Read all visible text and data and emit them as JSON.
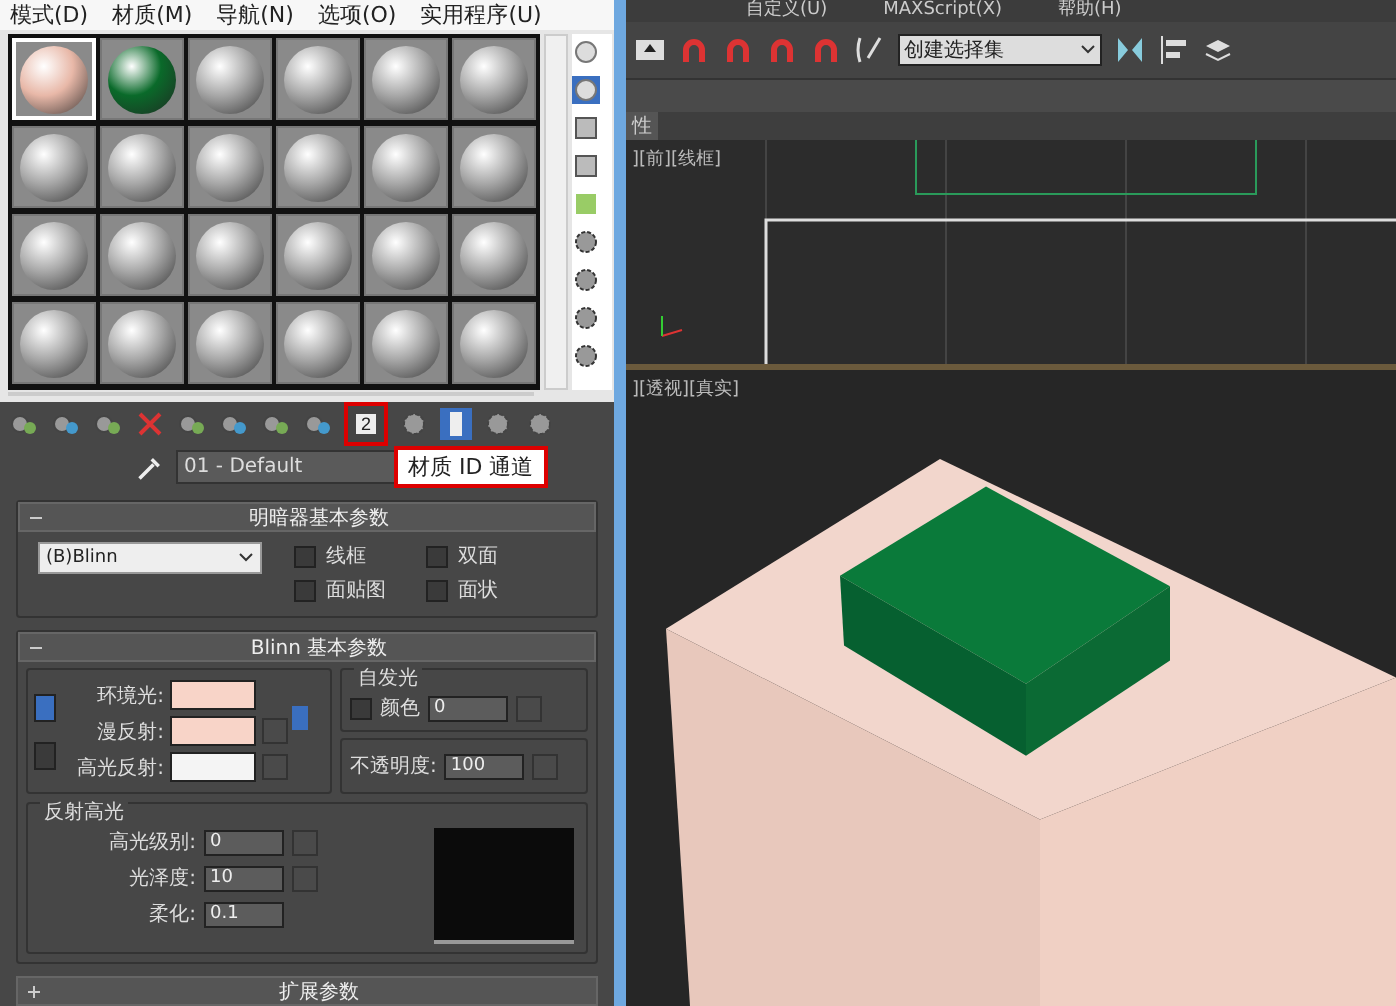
{
  "material_editor": {
    "menu": [
      "模式(D)",
      "材质(M)",
      "导航(N)",
      "选项(O)",
      "实用程序(U)"
    ],
    "sample_slots": [
      {
        "color": "#e8b8a8",
        "selected": true
      },
      {
        "color": "#0a6a2a",
        "selected": false
      },
      {
        "color": "#a8a8a8",
        "selected": false
      },
      {
        "color": "#a8a8a8",
        "selected": false
      },
      {
        "color": "#a8a8a8",
        "selected": false
      },
      {
        "color": "#a8a8a8",
        "selected": false
      },
      {
        "color": "#a8a8a8",
        "selected": false
      },
      {
        "color": "#a8a8a8",
        "selected": false
      },
      {
        "color": "#a8a8a8",
        "selected": false
      },
      {
        "color": "#a8a8a8",
        "selected": false
      },
      {
        "color": "#a8a8a8",
        "selected": false
      },
      {
        "color": "#a8a8a8",
        "selected": false
      },
      {
        "color": "#a8a8a8",
        "selected": false
      },
      {
        "color": "#a8a8a8",
        "selected": false
      },
      {
        "color": "#a8a8a8",
        "selected": false
      },
      {
        "color": "#a8a8a8",
        "selected": false
      },
      {
        "color": "#a8a8a8",
        "selected": false
      },
      {
        "color": "#a8a8a8",
        "selected": false
      },
      {
        "color": "#a8a8a8",
        "selected": false
      },
      {
        "color": "#a8a8a8",
        "selected": false
      },
      {
        "color": "#a8a8a8",
        "selected": false
      },
      {
        "color": "#a8a8a8",
        "selected": false
      },
      {
        "color": "#a8a8a8",
        "selected": false
      },
      {
        "color": "#a8a8a8",
        "selected": false
      }
    ],
    "id_channel_button": {
      "label": "2",
      "highlighted": true
    },
    "material_name": {
      "value": "01 - Default"
    },
    "tooltip": {
      "text": "材质 ID 通道",
      "highlighted": true
    },
    "shader_rollout": {
      "title": "明暗器基本参数",
      "expanded": true,
      "shader": "(B)Blinn",
      "options": [
        {
          "label": "线框",
          "checked": false
        },
        {
          "label": "双面",
          "checked": false
        },
        {
          "label": "面贴图",
          "checked": false
        },
        {
          "label": "面状",
          "checked": false
        }
      ]
    },
    "blinn_rollout": {
      "title": "Blinn 基本参数",
      "expanded": true,
      "colors": [
        {
          "label": "环境光:",
          "color": "#f8d4c8"
        },
        {
          "label": "漫反射:",
          "color": "#f8d4c8"
        },
        {
          "label": "高光反射:",
          "color": "#f4f4f4"
        }
      ],
      "self_illumination": {
        "title": "自发光",
        "label": "颜色",
        "checked": false,
        "value": "0"
      },
      "opacity": {
        "label": "不透明度:",
        "value": "100"
      },
      "specular": {
        "title": "反射高光",
        "fields": [
          {
            "label": "高光级别:",
            "value": "0"
          },
          {
            "label": "光泽度:",
            "value": "10"
          },
          {
            "label": "柔化:",
            "value": "0.1"
          }
        ]
      }
    },
    "extended_rollout": {
      "title": "扩展参数",
      "expanded": false
    }
  },
  "main_window": {
    "menu": [
      "自定义(U)",
      "MAXScript(X)",
      "帮助(H)"
    ],
    "selection_set": {
      "value": "创建选择集"
    },
    "tab": {
      "label": "性"
    },
    "viewports": [
      {
        "label": "][前][线框]",
        "kind": "front"
      },
      {
        "label": "][透视][真实]",
        "kind": "perspective"
      }
    ]
  }
}
